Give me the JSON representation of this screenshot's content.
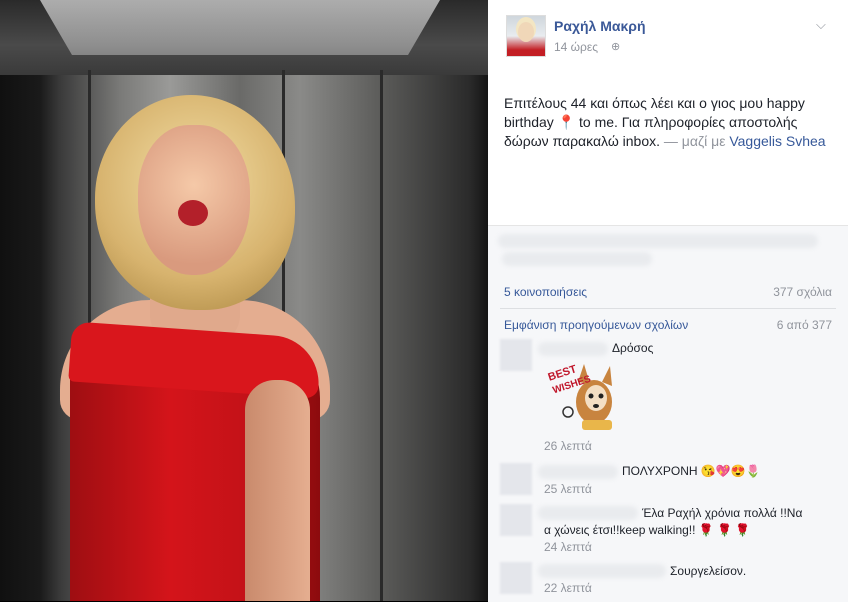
{
  "post": {
    "author": "Ραχήλ Μακρή",
    "time": "14 ώρες",
    "text_main": "Επιτέλους 44 και όπως λέει και ο γιος μου happy birthday 📍 to me. Για πληροφορίες αποστολής δώρων παρακαλώ inbox.",
    "with_text": "— μαζί με",
    "tagged": "Vaggelis Svhea"
  },
  "feedback": {
    "shares": "5 κοινοποιήσεις",
    "comments": "377 σχόλια",
    "previous_comments": "Εμφάνιση προηγούμενων σχολίων",
    "previous_count": "6 από 377"
  },
  "comments": [
    {
      "name": "Δρόσος",
      "sticker": "BEST WISHES",
      "time": "26 λεπτά"
    },
    {
      "text": "ΠΟΛΥΧΡΟΝΗ 😘💖😍🌷",
      "time": "25 λεπτά"
    },
    {
      "text_line1": "Έλα Ραχήλ χρόνια πολλά !!Να",
      "text_line2": "α χώνεις έτσι!!keep walking!! 🌹 🌹 🌹",
      "time": "24 λεπτά"
    },
    {
      "text": "Σουργελείσον.",
      "time": "22 λεπτά"
    }
  ],
  "icons": {
    "globe": "globe-icon",
    "chevron": "chevron-down-icon"
  }
}
